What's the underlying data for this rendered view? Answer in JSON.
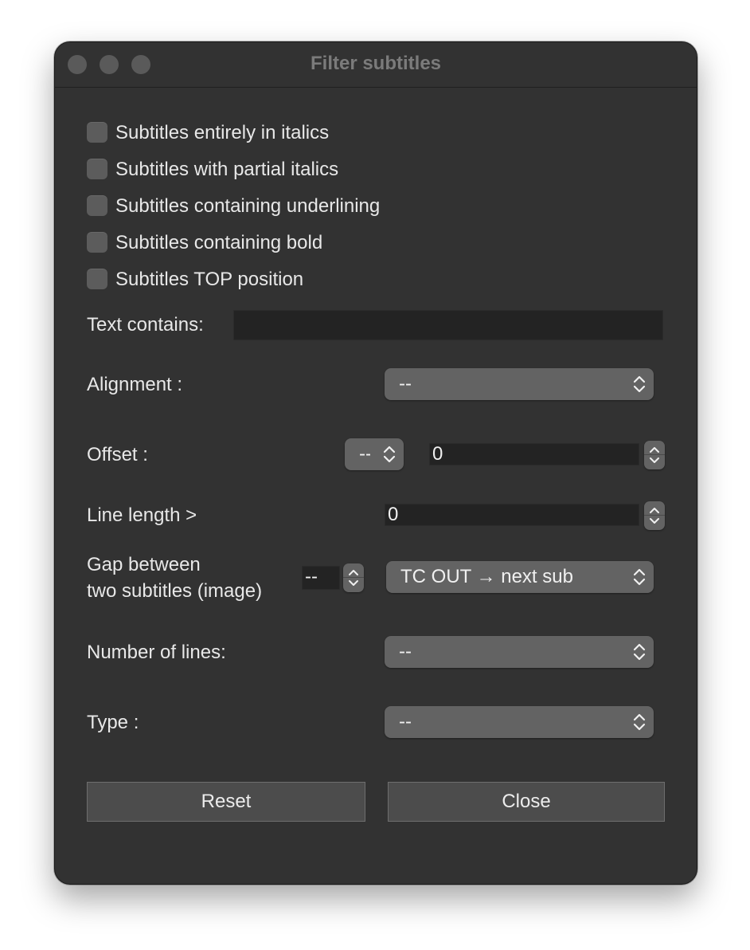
{
  "window": {
    "title": "Filter subtitles"
  },
  "checkboxes": [
    {
      "label": "Subtitles entirely in italics",
      "checked": false
    },
    {
      "label": "Subtitles with partial italics",
      "checked": false
    },
    {
      "label": "Subtitles containing underlining",
      "checked": false
    },
    {
      "label": "Subtitles containing bold",
      "checked": false
    },
    {
      "label": "Subtitles TOP position",
      "checked": false
    }
  ],
  "text_contains": {
    "label": "Text contains:",
    "value": ""
  },
  "alignment": {
    "label": "Alignment :",
    "value": "--"
  },
  "offset": {
    "label": "Offset :",
    "mode_value": "--",
    "value": "0"
  },
  "line_length": {
    "label": "Line length >",
    "value": "0"
  },
  "gap": {
    "label_line1": "Gap between",
    "label_line2": "two subtitles (image)",
    "value": "--",
    "mode": "TC OUT → next sub"
  },
  "number_of_lines": {
    "label": "Number of lines:",
    "value": "--"
  },
  "type": {
    "label": "Type :",
    "value": "--"
  },
  "buttons": {
    "reset": "Reset",
    "close": "Close"
  },
  "colors": {
    "window_bg": "#323232",
    "control_bg": "#636363",
    "field_bg": "#232323",
    "text": "#e8e8e8"
  }
}
